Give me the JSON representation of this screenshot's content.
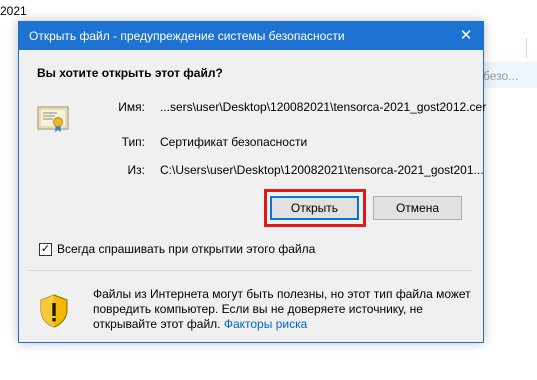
{
  "background": {
    "path_fragment": "2021",
    "right_column_text": "безо..."
  },
  "dialog": {
    "title": "Открыть файл - предупреждение системы безопасности",
    "close_glyph": "✕",
    "heading": "Вы хотите открыть этот файл?",
    "fields": {
      "name_label": "Имя:",
      "name_value": "...sers\\user\\Desktop\\120082021\\tensorca-2021_gost2012.cer",
      "type_label": "Тип:",
      "type_value": "Сертификат безопасности",
      "from_label": "Из:",
      "from_value": "C:\\Users\\user\\Desktop\\120082021\\tensorca-2021_gost201..."
    },
    "buttons": {
      "open": "Открыть",
      "cancel": "Отмена"
    },
    "checkbox": {
      "checked": true,
      "mark": "✓",
      "label": "Всегда спрашивать при открытии этого файла"
    },
    "warning": {
      "text": "Файлы из Интернета могут быть полезны, но этот тип файла может повредить компьютер. Если вы не доверяете источнику, не открывайте этот файл.",
      "link": "Факторы риска"
    },
    "colors": {
      "titlebar": "#1e73d2",
      "highlight": "#e01818",
      "link": "#0066cc"
    }
  }
}
